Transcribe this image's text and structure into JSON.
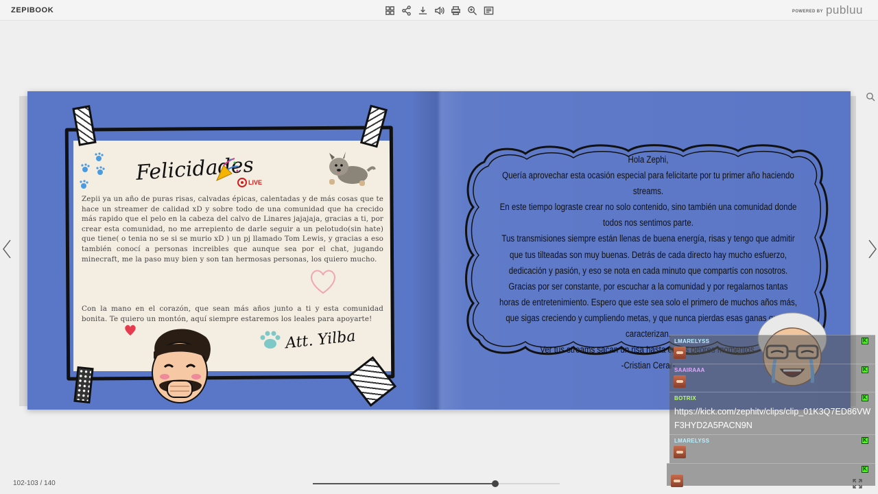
{
  "app": {
    "title": "ZEPIBOOK"
  },
  "toolbar": {
    "buttons": [
      {
        "name": "thumbnails-icon"
      },
      {
        "name": "share-icon"
      },
      {
        "name": "download-icon"
      },
      {
        "name": "sound-icon"
      },
      {
        "name": "print-icon"
      },
      {
        "name": "zoom-icon"
      },
      {
        "name": "table-of-contents-icon"
      }
    ]
  },
  "branding": {
    "powered_by": "POWERED BY",
    "brand": "publuu"
  },
  "left_page": {
    "heading": "Felicidades",
    "live_badge": "LIVE",
    "body": "Zepii ya un año de puras  risas, calvadas épicas, calentadas y de más cosas que te hace un streamer de calidad xD y sobre todo de una comunidad que ha crecido más rapido que el pelo en la cabeza del calvo de Linares jajajaja, gracias a ti, por crear esta comunidad, no me arrepiento de darle seguir a un pelotudo(sin hate) que tiene( o tenia no se si se murio xD ) un pj llamado Tom Lewis, y gracias a eso  también conocí a personas increibles que aunque sea por el chat, jugando minecraft, me la paso muy bien y son tan hermosas personas, los quiero mucho.",
    "closing": "Con la mano en el corazón, que sean más años junto a ti y esta comunidad bonita. Te quiero un montón, aquí siempre estaremos los leales para apoyarte!",
    "signature": "Att. Yilba"
  },
  "right_page": {
    "lines": [
      "Hola Zephi,",
      "Quería aprovechar esta ocasión especial para felicitarte por tu primer año haciendo streams.",
      "En este tiempo lograste crear no solo contenido, sino también una comunidad donde todos nos sentimos parte.",
      "Tus transmisiones siempre están llenas de buena energía, risas y tengo que admitir que tus tilteadas son muy buenas. Detrás de cada directo hay mucho esfuerzo, dedicación y pasión, y eso se nota en cada minuto que compartís con nosotros.",
      "Gracias por ser constante, por escuchar a la comunidad y por regalarnos tantas horas de entretenimiento. Espero que este sea solo el primero de muchos años más, que sigas creciendo y cumpliendo metas, y que nunca pierdas esas ganas que te caracterizan.",
      "Ver tus streams sacan un risa hasta en los peores momentos.",
      "-Cristian Cerar-"
    ]
  },
  "footer": {
    "page_indicator": "102-103 / 140",
    "progress": 0.74
  },
  "chat": [
    {
      "user": "LMARELYSS",
      "color": "#b9f0ff",
      "text": "",
      "emote": true
    },
    {
      "user": "SAAIRAAA",
      "color": "#e6a9ff",
      "text": "",
      "emote": true
    },
    {
      "user": "BOTRIX",
      "color": "#b8ff6a",
      "text": "https://kick.com/zephitv/clips/clip_01K3Q7ED86VWF3HYD2A5PACN9N",
      "emote": false
    },
    {
      "user": "LMARELYSS",
      "color": "#b9f0ff",
      "text": "",
      "emote": true
    },
    {
      "user": "",
      "color": "#9affb0",
      "text": "",
      "emote": true
    }
  ]
}
